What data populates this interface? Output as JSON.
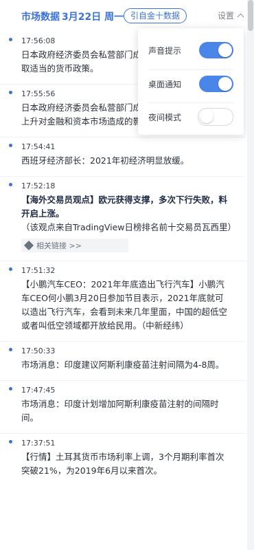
{
  "header": {
    "title": "市场数据",
    "date": "3月22日 周一",
    "quote_button": "引自金十数据",
    "settings_label": "设置"
  },
  "settings_menu": {
    "items": [
      {
        "label": "声音提示",
        "enabled": true
      },
      {
        "label": "桌面通知",
        "enabled": true
      },
      {
        "label": "夜间模式",
        "enabled": false
      }
    ]
  },
  "feed": [
    {
      "time": "17:56:08",
      "text": "日本政府经济委员会私营部门成员：日本央行应继续采取适当的货币政策。"
    },
    {
      "time": "17:55:56",
      "text": "日本政府经济委员会私营部门成员：需要留意美国利率上升对金融和资本市场造成的影响和波动。"
    },
    {
      "time": "17:54:41",
      "text": "西班牙经济部长：2021年初经济明显放缓。"
    },
    {
      "time": "17:52:18",
      "text": "【海外交易员观点】欧元获得支撑，多次下行失败，料开启上涨。",
      "note": "（该观点来自TradingView日榜排名前十交易员瓦西里）",
      "link": "相关链接 >>"
    },
    {
      "time": "17:51:32",
      "text": "【小鹏汽车CEO：2021年年底造出飞行汽车】小鹏汽车CEO何小鹏3月20日参加节目表示，2021年底就可以造出飞行汽车，会看到未来几年里面，中国的超低空或者叫低空领域都开放给民用。（中新经纬）"
    },
    {
      "time": "17:50:33",
      "text": "市场消息：印度建议阿斯利康疫苗注射间隔为4-8周。"
    },
    {
      "time": "17:47:45",
      "text": "市场消息：印度计划增加阿斯利康疫苗注射的间隔时间。"
    },
    {
      "time": "17:37:51",
      "text": "【行情】土耳其货币市场利率上调，3个月期利率首次突破21%，为2019年6月以来首次。"
    }
  ],
  "colors": {
    "accent": "#3b72d8",
    "toggle_on": "#4a86e8"
  }
}
